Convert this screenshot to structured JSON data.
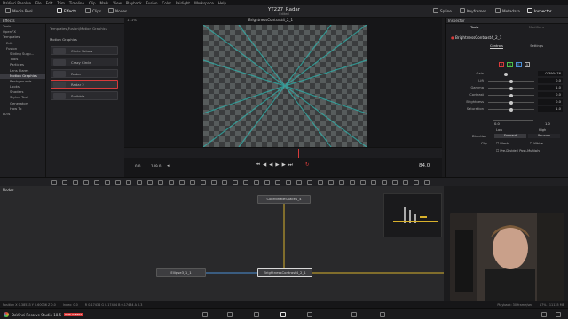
{
  "menubar": [
    "DaVinci Resolve",
    "File",
    "Edit",
    "Trim",
    "Timeline",
    "Clip",
    "Mark",
    "View",
    "Playback",
    "Fusion",
    "Color",
    "Fairlight",
    "Workspace",
    "Help"
  ],
  "toolbar": {
    "media_pool": "Media Pool",
    "effects": "Effects",
    "clips": "Clips",
    "nodes": "Nodes",
    "project_title": "YT227_Radar",
    "project_status": "Edited",
    "spline": "Spline",
    "keyframes": "Keyframes",
    "metadata": "Metadata",
    "inspector": "Inspector"
  },
  "effects_panel": {
    "title": "Effects",
    "tree": [
      "Tools",
      "OpenFX",
      "Templates",
      "Edit",
      "Fusion",
      "Sliding Supp...",
      "Tools",
      "Particles",
      "Lens Flares",
      "Motion Graphics",
      "Backgrounds",
      "Looks",
      "Shaders",
      "Styled Text",
      "Generators",
      "How To",
      "LUTs"
    ],
    "breadcrumb": "Templates\\Fusion\\Motion Graphics",
    "section": "Motion Graphics",
    "templates": [
      "Circle Values",
      "Crazy Circle",
      "Radar",
      "Radar 2",
      "Scribble"
    ]
  },
  "viewer": {
    "zoom": "111%",
    "clip_name": "BrightnessContrast4_2_1",
    "frame_start": "0.0",
    "frame_end": "149.0",
    "current_frame": "84.0"
  },
  "inspector": {
    "tabs": [
      "Tools",
      "Modifiers"
    ],
    "node_name": "BrightnessContrast4_2_1",
    "subtabs": [
      "Controls",
      "Settings"
    ],
    "channels": [
      "R",
      "G",
      "B",
      "A"
    ],
    "params": [
      {
        "label": "Gain",
        "value": "0.390476",
        "pos": 0.39
      },
      {
        "label": "Lift",
        "value": "0.0",
        "pos": 0.5
      },
      {
        "label": "Gamma",
        "value": "1.0",
        "pos": 0.5
      },
      {
        "label": "Contrast",
        "value": "0.0",
        "pos": 0.5
      },
      {
        "label": "Brightness",
        "value": "0.0",
        "pos": 0.5
      },
      {
        "label": "Saturation",
        "value": "1.0",
        "pos": 0.5
      }
    ],
    "low_value": "0.0",
    "high_value": "1.0",
    "low_label": "Low",
    "high_label": "High",
    "direction_label": "Direction",
    "direction_forward": "Forward",
    "direction_reverse": "Reverse",
    "clip_label": "Clip",
    "clip_black": "Black",
    "clip_white": "White",
    "predivide": "Pre-Divide / Post-Multiply"
  },
  "nodes_panel": {
    "title": "Nodes",
    "node_coord": "CoordinateSpace1_4",
    "node_ellipse": "Ellipse3_1_1",
    "node_bc": "BrightnessContrast4_2_1"
  },
  "statusbar": {
    "position": "Position X 0.38533 Y 0.60036 Z 0.0",
    "index": "Index: 0.0",
    "color": "R 0.17434 G 0.17434 B 0.17434 A 0.3",
    "playback": "Playback: 30 frame/sec",
    "memory": "17% - 11135 MB"
  },
  "app": {
    "name": "DaVinci Resolve Studio 18.5",
    "badge": "PUBLIC BETA"
  },
  "colors": {
    "accent": "#d83b3b",
    "node_link": "#d8b12c",
    "node_link_blue": "#4c8fd6",
    "cyan": "#2fb7b0"
  }
}
